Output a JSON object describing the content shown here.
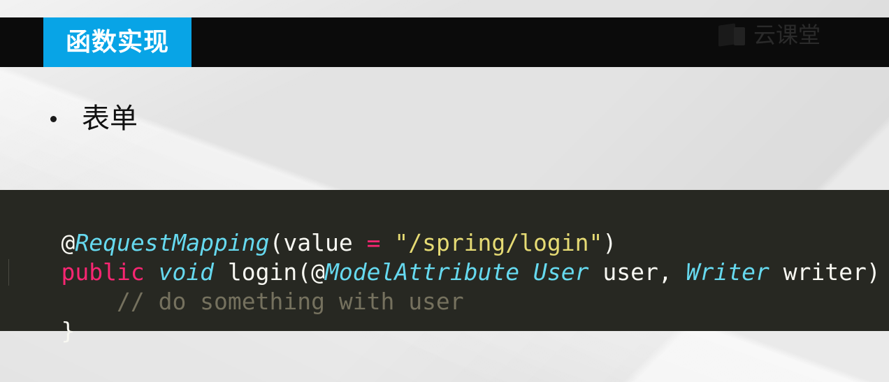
{
  "header": {
    "title": "函数实现",
    "brand_name": "云课堂",
    "brand_icon": "book-logo-icon"
  },
  "content": {
    "bullets": [
      {
        "text": "表单"
      }
    ]
  },
  "code": {
    "language": "java",
    "theme_colors": {
      "background": "#272822",
      "plain": "#f8f8f2",
      "type": "#66d9ef",
      "keyword": "#f92672",
      "string": "#e6db74",
      "comment": "#75715e"
    },
    "lines": [
      [
        {
          "kind": "plain",
          "text": "@"
        },
        {
          "kind": "type",
          "text": "RequestMapping"
        },
        {
          "kind": "plain",
          "text": "(value "
        },
        {
          "kind": "op",
          "text": "="
        },
        {
          "kind": "plain",
          "text": " "
        },
        {
          "kind": "string",
          "text": "\"/spring/login\""
        },
        {
          "kind": "plain",
          "text": ")"
        }
      ],
      [
        {
          "kind": "keyword",
          "text": "public"
        },
        {
          "kind": "plain",
          "text": " "
        },
        {
          "kind": "type",
          "text": "void"
        },
        {
          "kind": "plain",
          "text": " login(@"
        },
        {
          "kind": "type",
          "text": "ModelAttribute"
        },
        {
          "kind": "plain",
          "text": " "
        },
        {
          "kind": "type",
          "text": "User"
        },
        {
          "kind": "plain",
          "text": " user, "
        },
        {
          "kind": "type",
          "text": "Writer"
        },
        {
          "kind": "plain",
          "text": " writer) {"
        }
      ],
      [
        {
          "kind": "plain",
          "text": "    "
        },
        {
          "kind": "comment",
          "text": "// do something with user"
        }
      ],
      [
        {
          "kind": "plain",
          "text": "}"
        }
      ]
    ]
  }
}
